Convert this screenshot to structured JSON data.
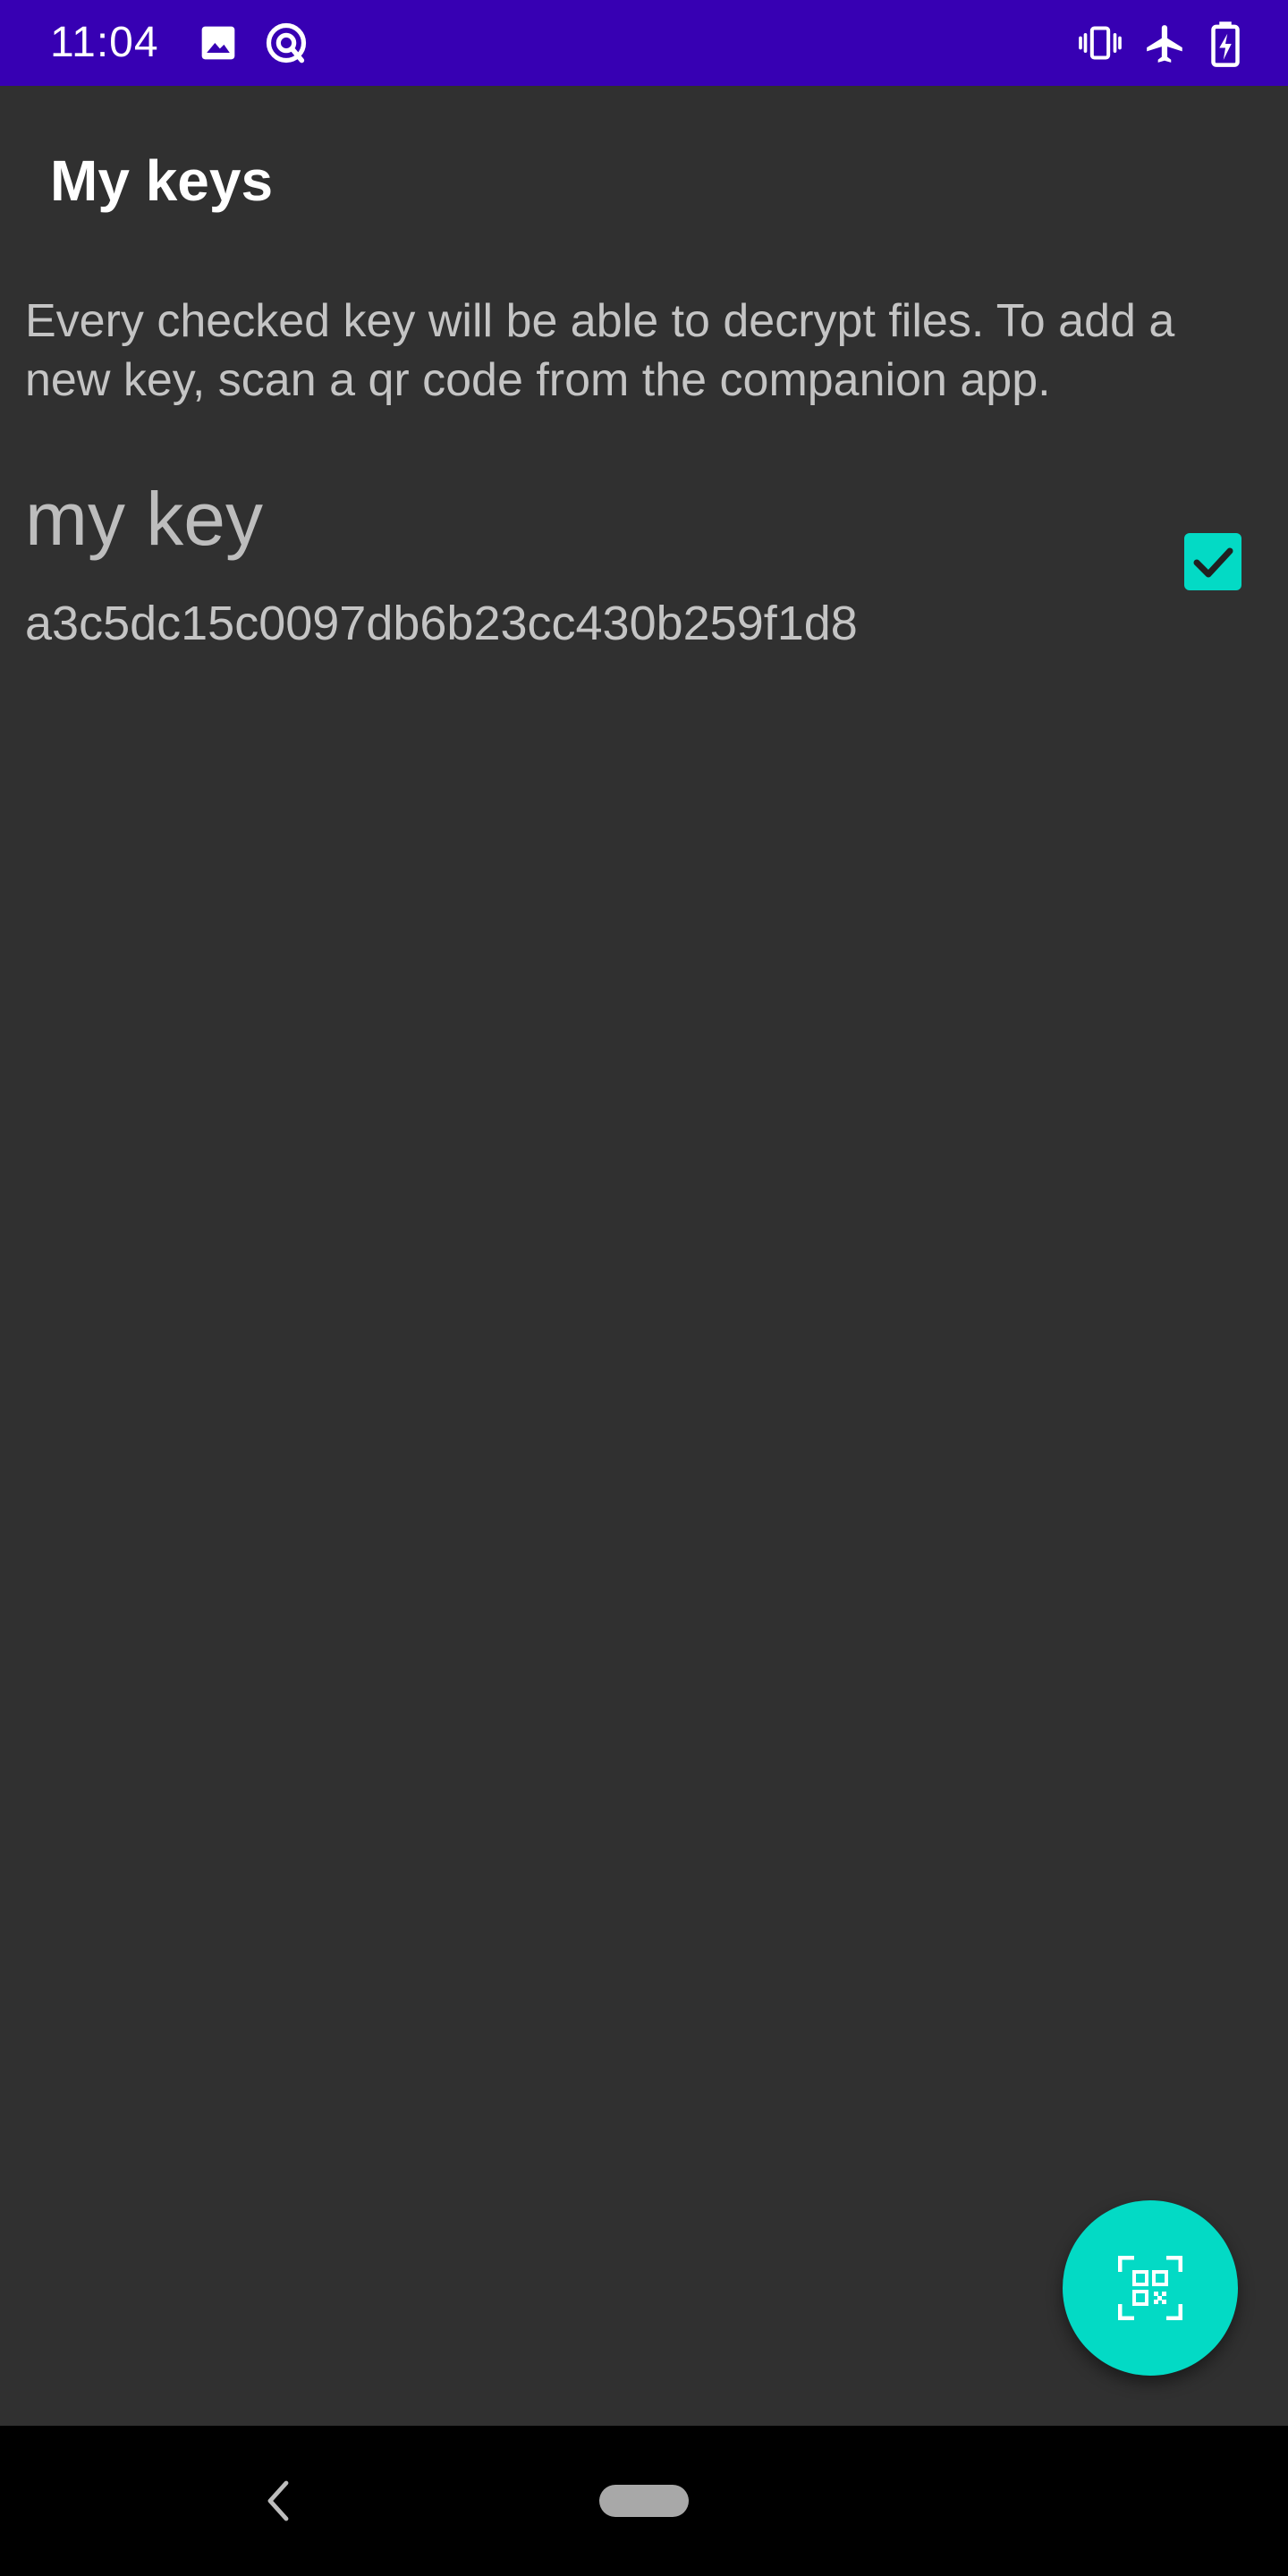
{
  "status_bar": {
    "time": "11:04",
    "left_icons": [
      "image-icon",
      "sync-status-icon"
    ],
    "right_icons": [
      "vibrate-icon",
      "airplane-mode-icon",
      "battery-charging-icon"
    ],
    "background_color": "#3700b3"
  },
  "app_bar": {
    "title": "My keys"
  },
  "main": {
    "description": "Every checked key will be able to decrypt files. To add a new key, scan a qr code from the companion app.",
    "keys": [
      {
        "name": "my key",
        "id": "a3c5dc15c0097db6b23cc430b259f1d8",
        "checked": true
      }
    ]
  },
  "fab": {
    "icon": "qr-code-scan-icon",
    "color": "#03dac5"
  },
  "nav_bar": {
    "icons": [
      "back-icon",
      "home-pill"
    ]
  }
}
